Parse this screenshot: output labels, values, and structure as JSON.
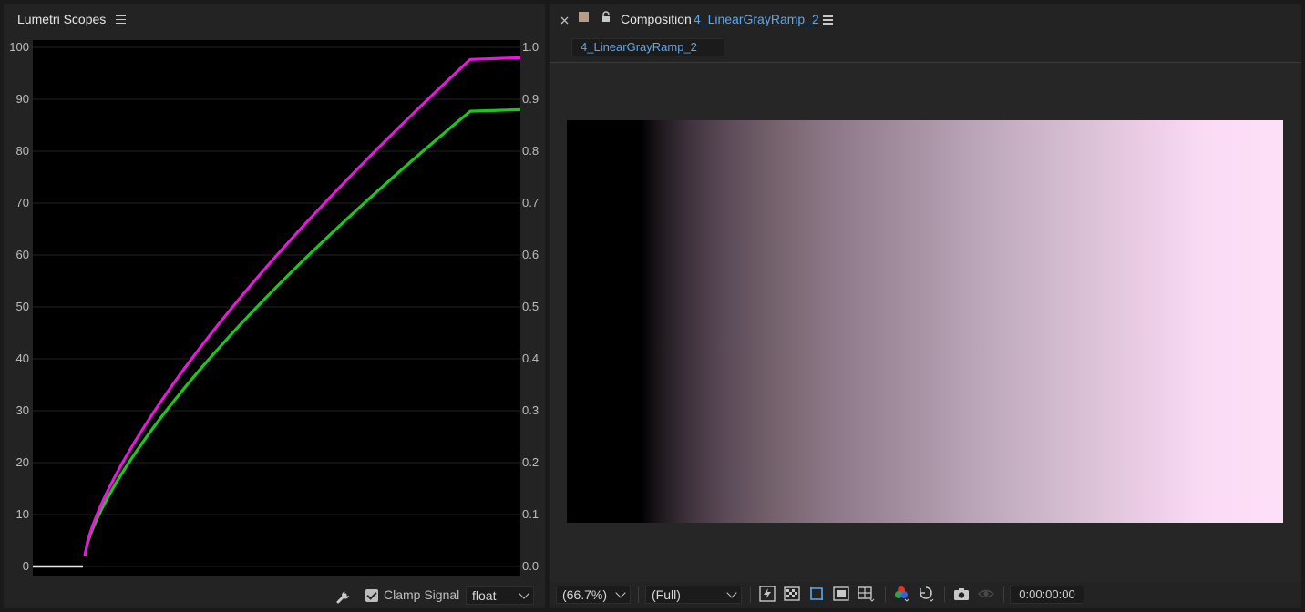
{
  "scopes": {
    "title": "Lumetri Scopes",
    "left_ticks": [
      "100",
      "90",
      "80",
      "70",
      "60",
      "50",
      "40",
      "30",
      "20",
      "10",
      "0"
    ],
    "right_ticks": [
      "1.0",
      "0.9",
      "0.8",
      "0.7",
      "0.6",
      "0.5",
      "0.4",
      "0.3",
      "0.2",
      "0.1",
      "0.0"
    ],
    "clamp_label": "Clamp Signal",
    "clamp_checked": true,
    "format_value": "float",
    "colors": {
      "magenta": "#e31ad9",
      "green": "#1ec51e",
      "baseline": "#e8e8e8"
    }
  },
  "composition": {
    "title": "Composition",
    "comp_name": "4_LinearGrayRamp_2",
    "tab_label": "4_LinearGrayRamp_2",
    "zoom_value": "(66.7%)",
    "resolution_value": "(Full)",
    "timecode": "0:00:00:00",
    "accent": "#5aa8f0"
  },
  "icons": {
    "close": "close-icon",
    "color_label": "color-label-swatch",
    "lock": "lock-icon",
    "menu": "hamburger-menu-icon",
    "wrench": "wrench-icon"
  }
}
